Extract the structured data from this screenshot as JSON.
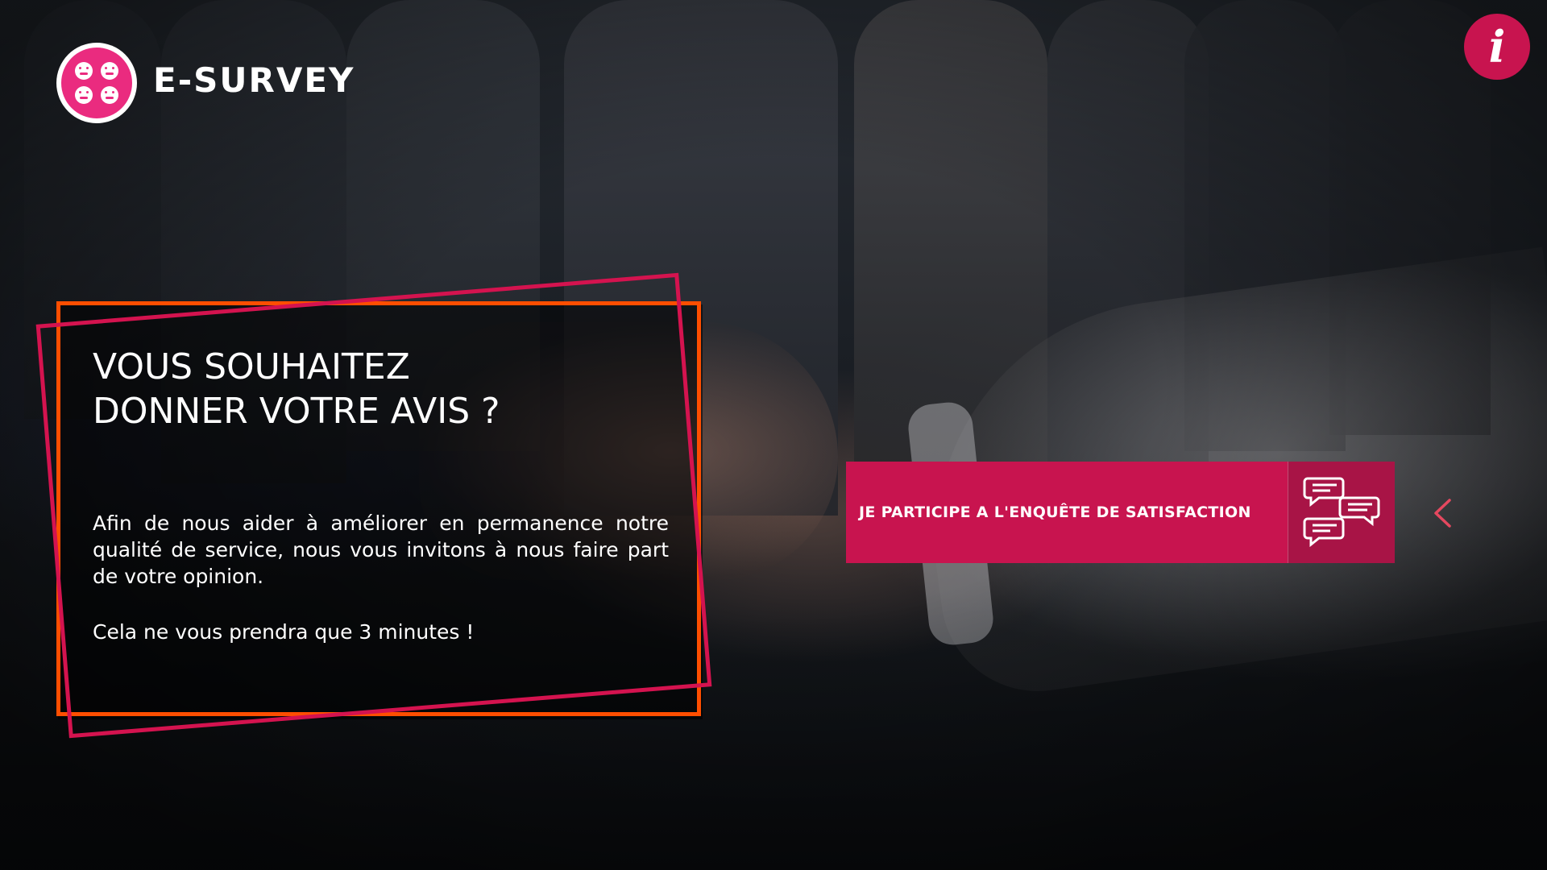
{
  "header": {
    "brand": "E-SURVEY",
    "logo_icon": "smiley-grid-icon",
    "info_label": "i"
  },
  "card": {
    "title_line1": "VOUS SOUHAITEZ",
    "title_line2": "DONNER VOTRE AVIS ?",
    "body": "Afin de nous aider à améliorer en permanence notre qualité de service, nous vous invitons à nous faire part de votre opinion.",
    "note": "Cela ne vous prendra que 3 minutes !"
  },
  "cta": {
    "label": "JE PARTICIPE A L'ENQUÊTE DE SATISFACTION",
    "icon": "chat-bubbles-icon"
  },
  "nav": {
    "icon": "chevron-left-icon"
  },
  "colors": {
    "accent": "#c8144f",
    "accent_dark": "#a81446",
    "orange": "#ff4e00",
    "logo_pink": "#ea2b7f"
  }
}
